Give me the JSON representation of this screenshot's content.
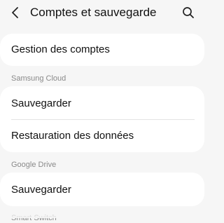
{
  "header": {
    "title": "Comptes et sauvegarde",
    "back_icon": "chevron-left-icon",
    "search_icon": "search-icon"
  },
  "accounts_card": {
    "item_label": "Gestion des comptes"
  },
  "samsung_cloud": {
    "section_label": "Samsung Cloud",
    "items": [
      {
        "label": "Sauvegarder"
      },
      {
        "label": "Restauration des données"
      }
    ]
  },
  "google_drive": {
    "section_label": "Google Drive",
    "items": [
      {
        "label": "Sauvegarder"
      }
    ]
  },
  "smart_switch": {
    "section_label": "Smart Switch"
  },
  "colors": {
    "background": "#f6f6f6",
    "card": "#ffffff",
    "section_text": "#8a8a8a",
    "primary_text": "#111111"
  }
}
